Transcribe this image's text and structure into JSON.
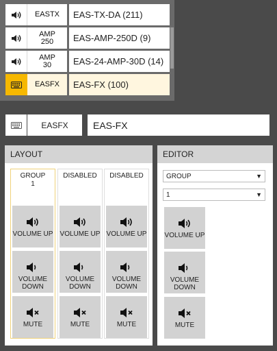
{
  "zone_list": [
    {
      "code": "EASTX",
      "name": "EAS-TX-DA (211)",
      "icon": "speaker-icon",
      "selected": false
    },
    {
      "code": "AMP\n250",
      "name": "EAS-AMP-250D (9)",
      "icon": "speaker-icon",
      "selected": false
    },
    {
      "code": "AMP\n30",
      "name": "EAS-24-AMP-30D (14)",
      "icon": "speaker-icon",
      "selected": false
    },
    {
      "code": "EASFX",
      "name": "EAS-FX (100)",
      "icon": "keyboard-icon",
      "selected": true
    }
  ],
  "selected_zone": {
    "code": "EASFX",
    "name": "EAS-FX",
    "icon": "keyboard-icon"
  },
  "layout": {
    "title": "LAYOUT",
    "columns": [
      {
        "title": "GROUP\n1",
        "active": true
      },
      {
        "title": "DISABLED",
        "active": false
      },
      {
        "title": "DISABLED",
        "active": false
      }
    ],
    "buttons": [
      {
        "label": "VOLUME UP",
        "icon": "volume-up-icon"
      },
      {
        "label": "VOLUME\nDOWN",
        "icon": "volume-down-icon"
      },
      {
        "label": "MUTE",
        "icon": "mute-icon"
      }
    ]
  },
  "editor": {
    "title": "EDITOR",
    "type_select": "GROUP",
    "number_select": "1",
    "buttons": [
      {
        "label": "VOLUME UP",
        "icon": "volume-up-icon"
      },
      {
        "label": "VOLUME\nDOWN",
        "icon": "volume-down-icon"
      },
      {
        "label": "MUTE",
        "icon": "mute-icon"
      }
    ]
  },
  "colors": {
    "accent": "#f6b800",
    "selected_row": "#fff6df",
    "panel_header": "#d4d4d4",
    "tile": "#d2d2d2"
  }
}
